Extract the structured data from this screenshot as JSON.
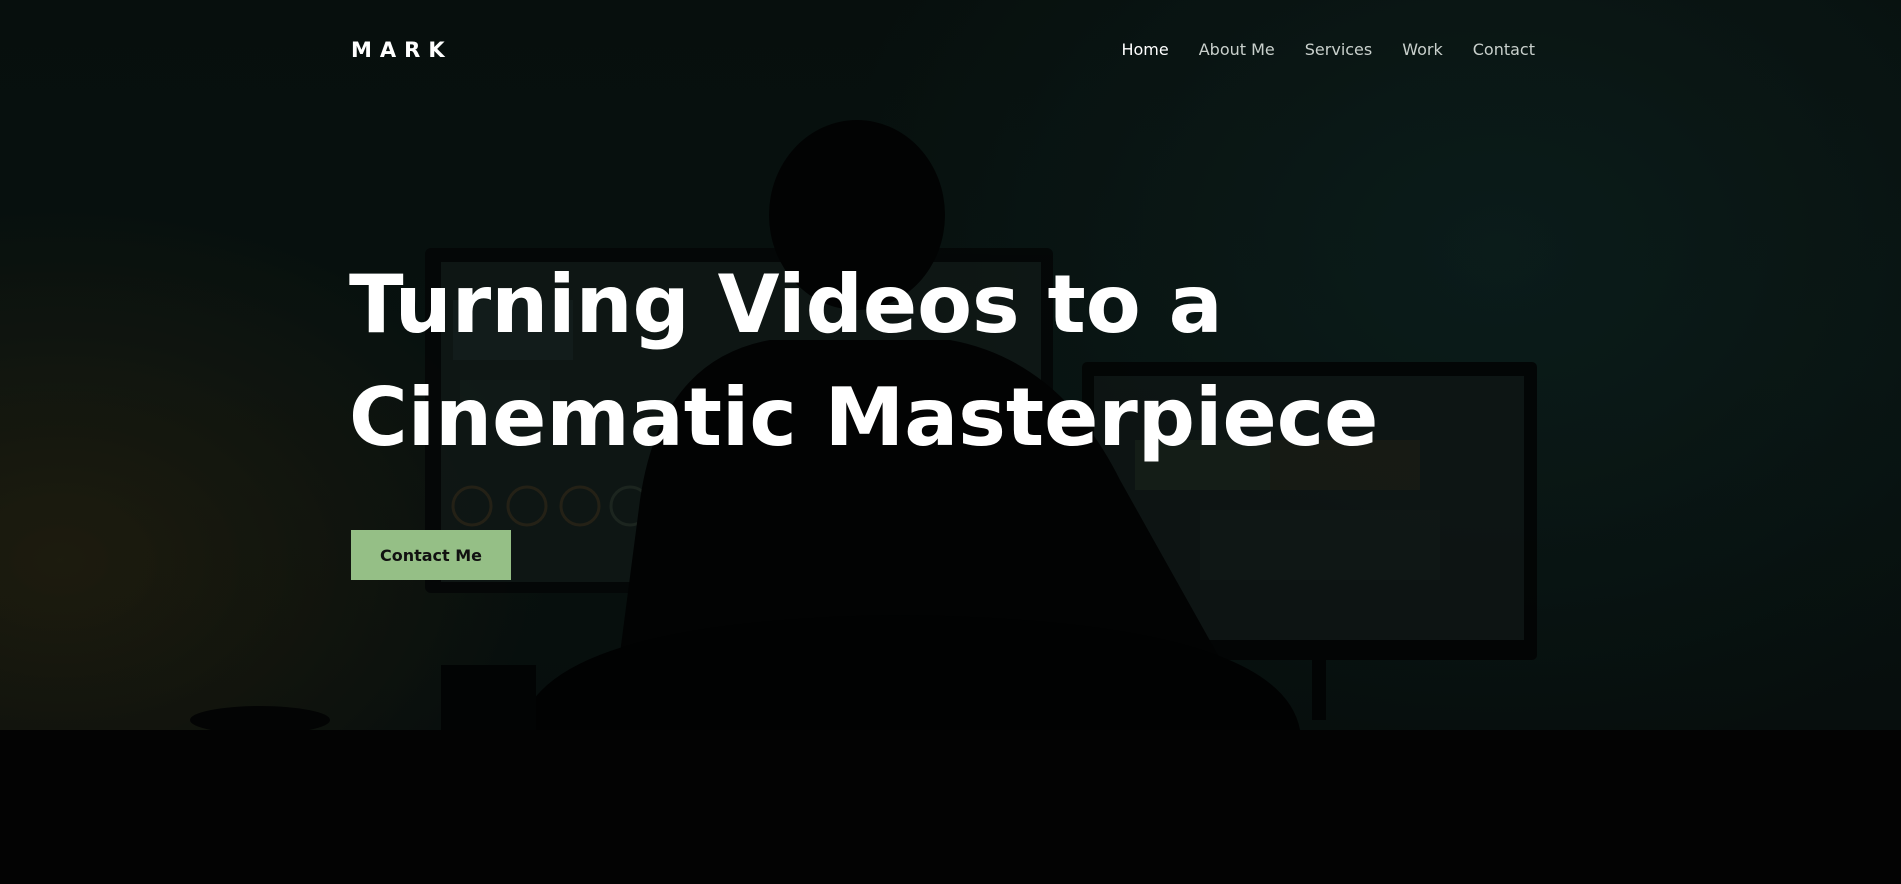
{
  "brand": {
    "logo_text": "MARK"
  },
  "nav": {
    "items": [
      {
        "label": "Home",
        "active": true
      },
      {
        "label": "About Me",
        "active": false
      },
      {
        "label": "Services",
        "active": false
      },
      {
        "label": "Work",
        "active": false
      },
      {
        "label": "Contact",
        "active": false
      }
    ]
  },
  "hero": {
    "headline_line1": "Turning Videos to a",
    "headline_line2": "Cinematic Masterpiece",
    "cta_label": "Contact Me",
    "background_image": "person-editing-video-at-monitors"
  },
  "colors": {
    "accent": "#95bf86",
    "text": "#ffffff",
    "nav_text": "#c9d0cc",
    "background": "#030404"
  }
}
